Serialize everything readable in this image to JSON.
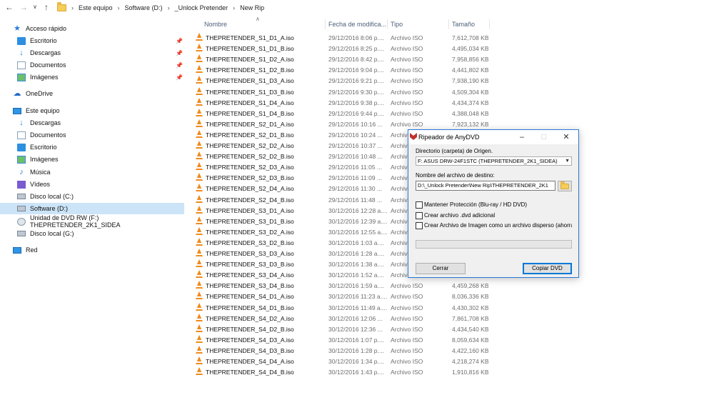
{
  "address_bar": {
    "crumbs": [
      "Este equipo",
      "Software (D:)",
      "_Unlock Pretender",
      "New Rip"
    ]
  },
  "sidebar": {
    "items": [
      {
        "label": "Acceso rápido",
        "icon": "star-icon",
        "pinned": false
      },
      {
        "label": "Escritorio",
        "icon": "desktop-icon",
        "pinned": true
      },
      {
        "label": "Descargas",
        "icon": "downloads-icon",
        "pinned": true
      },
      {
        "label": "Documentos",
        "icon": "documents-icon",
        "pinned": true
      },
      {
        "label": "Imágenes",
        "icon": "pictures-icon",
        "pinned": true
      },
      {
        "label": "OneDrive",
        "icon": "cloud-icon",
        "pinned": false
      },
      {
        "label": "Este equipo",
        "icon": "computer-icon",
        "pinned": false
      },
      {
        "label": "Descargas",
        "icon": "downloads-icon",
        "pinned": false
      },
      {
        "label": "Documentos",
        "icon": "documents-icon",
        "pinned": false
      },
      {
        "label": "Escritorio",
        "icon": "desktop-icon",
        "pinned": false
      },
      {
        "label": "Imágenes",
        "icon": "pictures-icon",
        "pinned": false
      },
      {
        "label": "Música",
        "icon": "music-icon",
        "pinned": false
      },
      {
        "label": "Vídeos",
        "icon": "videos-icon",
        "pinned": false
      },
      {
        "label": "Disco local (C:)",
        "icon": "drive-icon",
        "pinned": false
      },
      {
        "label": "Software (D:)",
        "icon": "drive-icon",
        "pinned": false,
        "selected": true
      },
      {
        "label": "Unidad de DVD RW (F:) THEPRETENDER_2K1_SIDEA",
        "icon": "dvd-drive-icon",
        "pinned": false
      },
      {
        "label": "Disco local (G:)",
        "icon": "drive-icon",
        "pinned": false
      },
      {
        "label": "Red",
        "icon": "network-icon",
        "pinned": false
      }
    ]
  },
  "file_list": {
    "columns": {
      "name": "Nombre",
      "date": "Fecha de modifica...",
      "type": "Tipo",
      "size": "Tamaño"
    },
    "rows": [
      {
        "name": "THEPRETENDER_S1_D1_A.iso",
        "date": "29/12/2016 8:06 p....",
        "type": "Archivo ISO",
        "size": "7,612,708 KB"
      },
      {
        "name": "THEPRETENDER_S1_D1_B.iso",
        "date": "29/12/2016 8:25 p....",
        "type": "Archivo ISO",
        "size": "4,495,034 KB"
      },
      {
        "name": "THEPRETENDER_S1_D2_A.iso",
        "date": "29/12/2016 8:42 p....",
        "type": "Archivo ISO",
        "size": "7,958,856 KB"
      },
      {
        "name": "THEPRETENDER_S1_D2_B.iso",
        "date": "29/12/2016 9:04 p....",
        "type": "Archivo ISO",
        "size": "4,441,802 KB"
      },
      {
        "name": "THEPRETENDER_S1_D3_A.iso",
        "date": "29/12/2016 9:21 p....",
        "type": "Archivo ISO",
        "size": "7,938,190 KB"
      },
      {
        "name": "THEPRETENDER_S1_D3_B.iso",
        "date": "29/12/2016 9:30 p....",
        "type": "Archivo ISO",
        "size": "4,509,304 KB"
      },
      {
        "name": "THEPRETENDER_S1_D4_A.iso",
        "date": "29/12/2016 9:38 p....",
        "type": "Archivo ISO",
        "size": "4,434,374 KB"
      },
      {
        "name": "THEPRETENDER_S1_D4_B.iso",
        "date": "29/12/2016 9:44 p....",
        "type": "Archivo ISO",
        "size": "4,388,048 KB"
      },
      {
        "name": "THEPRETENDER_S2_D1_A.iso",
        "date": "29/12/2016 10:16 ...",
        "type": "Archivo ISO",
        "size": "7,923,132 KB"
      },
      {
        "name": "THEPRETENDER_S2_D1_B.iso",
        "date": "29/12/2016 10:24 ...",
        "type": "Archiv",
        "size": ""
      },
      {
        "name": "THEPRETENDER_S2_D2_A.iso",
        "date": "29/12/2016 10:37 ...",
        "type": "Archiv",
        "size": ""
      },
      {
        "name": "THEPRETENDER_S2_D2_B.iso",
        "date": "29/12/2016 10:48 ...",
        "type": "Archiv",
        "size": ""
      },
      {
        "name": "THEPRETENDER_S2_D3_A.iso",
        "date": "29/12/2016 11:05 ...",
        "type": "Archiv",
        "size": ""
      },
      {
        "name": "THEPRETENDER_S2_D3_B.iso",
        "date": "29/12/2016 11:09 ...",
        "type": "Archiv",
        "size": ""
      },
      {
        "name": "THEPRETENDER_S2_D4_A.iso",
        "date": "29/12/2016 11:30 ...",
        "type": "Archiv",
        "size": ""
      },
      {
        "name": "THEPRETENDER_S2_D4_B.iso",
        "date": "29/12/2016 11:48 ...",
        "type": "Archiv",
        "size": ""
      },
      {
        "name": "THEPRETENDER_S3_D1_A.iso",
        "date": "30/12/2016 12:28 a....",
        "type": "Archiv",
        "size": ""
      },
      {
        "name": "THEPRETENDER_S3_D1_B.iso",
        "date": "30/12/2016 12:39 a....",
        "type": "Archiv",
        "size": ""
      },
      {
        "name": "THEPRETENDER_S3_D2_A.iso",
        "date": "30/12/2016 12:55 a....",
        "type": "Archiv",
        "size": ""
      },
      {
        "name": "THEPRETENDER_S3_D2_B.iso",
        "date": "30/12/2016 1:03 a....",
        "type": "Archiv",
        "size": ""
      },
      {
        "name": "THEPRETENDER_S3_D3_A.iso",
        "date": "30/12/2016 1:28 a....",
        "type": "Archiv",
        "size": ""
      },
      {
        "name": "THEPRETENDER_S3_D3_B.iso",
        "date": "30/12/2016 1:38 a....",
        "type": "Archiv",
        "size": ""
      },
      {
        "name": "THEPRETENDER_S3_D4_A.iso",
        "date": "30/12/2016 1:52 a....",
        "type": "Archiv",
        "size": ""
      },
      {
        "name": "THEPRETENDER_S3_D4_B.iso",
        "date": "30/12/2016 1:59 a....",
        "type": "Archivo ISO",
        "size": "4,459,268 KB"
      },
      {
        "name": "THEPRETENDER_S4_D1_A.iso",
        "date": "30/12/2016 11:23 a....",
        "type": "Archivo ISO",
        "size": "8,036,336 KB"
      },
      {
        "name": "THEPRETENDER_S4_D1_B.iso",
        "date": "30/12/2016 11:49 a....",
        "type": "Archivo ISO",
        "size": "4,430,302 KB"
      },
      {
        "name": "THEPRETENDER_S4_D2_A.iso",
        "date": "30/12/2016 12:06 ...",
        "type": "Archivo ISO",
        "size": "7,861,708 KB"
      },
      {
        "name": "THEPRETENDER_S4_D2_B.iso",
        "date": "30/12/2016 12:36 ...",
        "type": "Archivo ISO",
        "size": "4,434,540 KB"
      },
      {
        "name": "THEPRETENDER_S4_D3_A.iso",
        "date": "30/12/2016 1:07 p....",
        "type": "Archivo ISO",
        "size": "8,059,634 KB"
      },
      {
        "name": "THEPRETENDER_S4_D3_B.iso",
        "date": "30/12/2016 1:28 p....",
        "type": "Archivo ISO",
        "size": "4,422,160 KB"
      },
      {
        "name": "THEPRETENDER_S4_D4_A.iso",
        "date": "30/12/2016 1:34 p....",
        "type": "Archivo ISO",
        "size": "4,218,274 KB"
      },
      {
        "name": "THEPRETENDER_S4_D4_B.iso",
        "date": "30/12/2016 1:43 p....",
        "type": "Archivo ISO",
        "size": "1,910,816 KB"
      }
    ]
  },
  "dialog": {
    "title": "Ripeador de AnyDVD",
    "source_label": "Directorio (carpeta) de Origen.",
    "source_value": "F: ASUS DRW-24F1STC (THEPRETENDER_2K1_SIDEA)",
    "dest_label": "Nombre del archivo de destino:",
    "dest_value": "D:\\_Unlock Pretender\\New Rip\\THEPRETENDER_2K1",
    "options": [
      {
        "label": "Mantener Protección (Blu-ray / HD DVD)",
        "checked": false
      },
      {
        "label": "Crear archivo .dvd adicional",
        "checked": false
      },
      {
        "label": "Crear Archivo de Imagen como un archivo disperso (ahorra es",
        "checked": false
      }
    ],
    "cancel_label": "Cerrar",
    "copy_label": "Copiar DVD",
    "progress": 0
  }
}
